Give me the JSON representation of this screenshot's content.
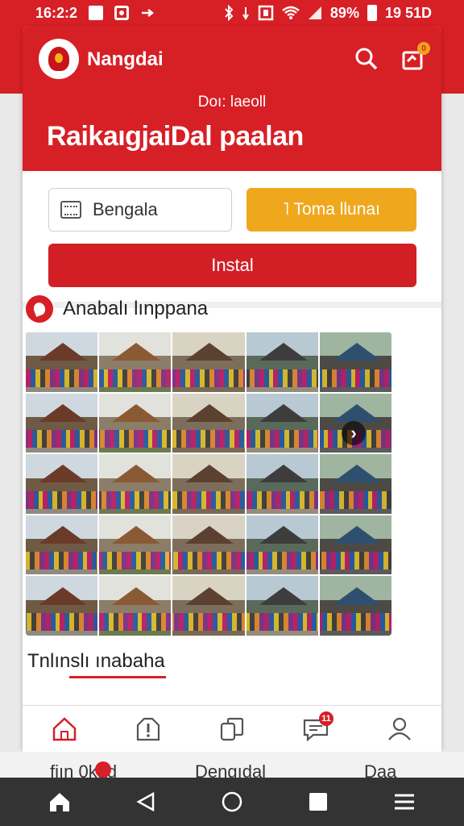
{
  "status_bar": {
    "time": "16:2:2",
    "battery": "89%",
    "clock_right": "19 51D",
    "icons": [
      "square-icon",
      "image-icon",
      "arrow-icon",
      "bluetooth-icon",
      "vibrate-icon",
      "nfc-icon",
      "wifi-icon",
      "signal-icon",
      "battery-icon"
    ]
  },
  "header": {
    "app_name": "Nangdai",
    "subtitle": "Doı: laeoll",
    "page_title": "RaikaıgjaiDal paalan",
    "notif_count": "0"
  },
  "controls": {
    "language_value": "Bengala",
    "secondary_button": "˥ Toma llunaı",
    "install_button": "Instal"
  },
  "gallery_section": {
    "title": "Anabalı lınppana",
    "tiles": 25
  },
  "bottom_section": {
    "label": "Tnlınslı ınabaha"
  },
  "nav": {
    "items": [
      {
        "name": "home",
        "icon": "home-icon"
      },
      {
        "name": "alerts",
        "icon": "alert-icon"
      },
      {
        "name": "files",
        "icon": "files-icon"
      },
      {
        "name": "messages",
        "icon": "message-icon",
        "badge": "11"
      },
      {
        "name": "profile",
        "icon": "profile-icon"
      }
    ]
  },
  "under_bar": {
    "item1": "fiın 0kad",
    "item2": "Dengıdal",
    "item3": "Daa"
  },
  "colors": {
    "brand_red": "#d71f26",
    "accent_yellow": "#efa81e"
  }
}
